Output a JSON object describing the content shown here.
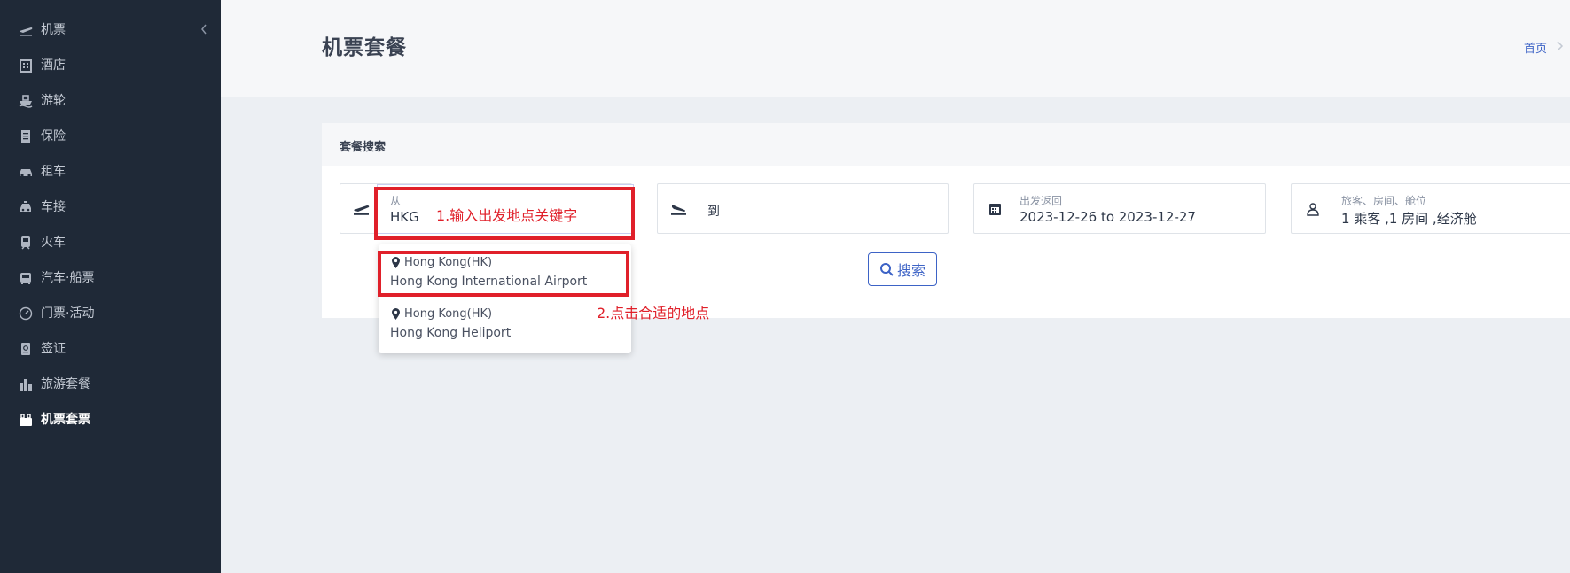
{
  "sidebar": {
    "items": [
      {
        "label": "机票",
        "icon": "plane-icon"
      },
      {
        "label": "酒店",
        "icon": "building-icon"
      },
      {
        "label": "游轮",
        "icon": "ship-icon"
      },
      {
        "label": "保险",
        "icon": "document-icon"
      },
      {
        "label": "租车",
        "icon": "car-icon"
      },
      {
        "label": "车接",
        "icon": "taxi-icon"
      },
      {
        "label": "火车",
        "icon": "train-icon"
      },
      {
        "label": "汽车·船票",
        "icon": "bus-icon"
      },
      {
        "label": "门票·活动",
        "icon": "gauge-icon"
      },
      {
        "label": "签证",
        "icon": "passport-icon"
      },
      {
        "label": "旅游套餐",
        "icon": "city-icon"
      },
      {
        "label": "机票套票",
        "icon": "luggage-icon"
      }
    ],
    "active_index": 11
  },
  "header": {
    "title": "机票套餐",
    "breadcrumb_home": "首页"
  },
  "search_card": {
    "title": "套餐搜索",
    "from": {
      "label": "从",
      "value": "HKG"
    },
    "to": {
      "placeholder": "到"
    },
    "dates": {
      "label": "出发返回",
      "value": "2023-12-26 to 2023-12-27"
    },
    "travelers": {
      "label": "旅客、房间、舱位",
      "value": "1 乘客 ,1 房间 ,经济舱"
    },
    "search_button": "搜索"
  },
  "dropdown": {
    "options": [
      {
        "city": "Hong Kong(HK)",
        "airport": "Hong Kong International Airport"
      },
      {
        "city": "Hong Kong(HK)",
        "airport": "Hong Kong Heliport"
      }
    ]
  },
  "annotations": {
    "step1": "1.输入出发地点关键字",
    "step2": "2.点击合适的地点"
  },
  "colors": {
    "sidebar_bg": "#1f2937",
    "accent": "#3d63c6",
    "annotation": "#e0202a"
  }
}
